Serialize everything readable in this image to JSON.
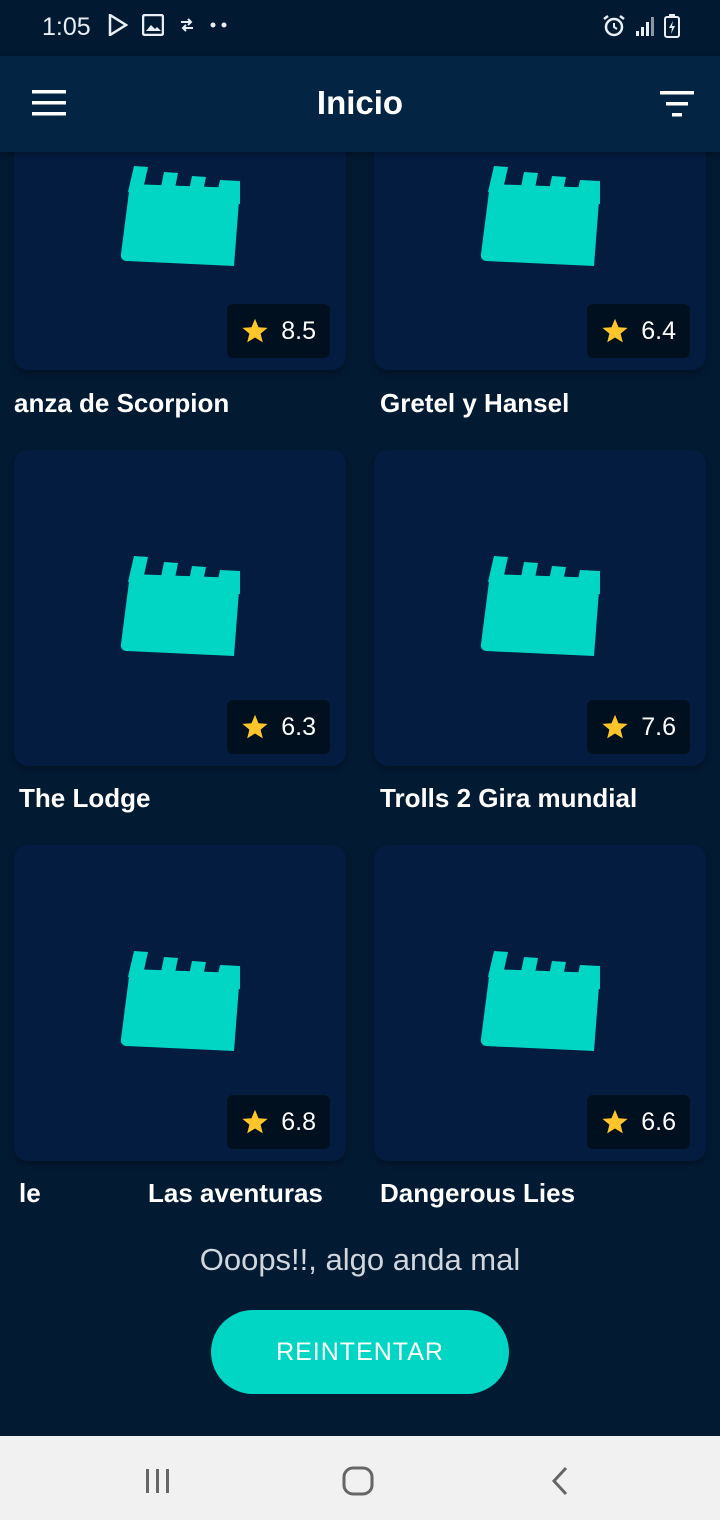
{
  "status_bar": {
    "time": "1:05",
    "icons": [
      "play-store-icon",
      "image-icon",
      "data-sync-icon",
      "more-dots-icon",
      "alarm-icon",
      "signal-icon",
      "battery-icon"
    ]
  },
  "app_bar": {
    "title": "Inicio",
    "icons": [
      "hamburger-menu-icon",
      "filter-icon"
    ]
  },
  "movies": [
    {
      "title": "anza de Scorpion",
      "rating": "8.5"
    },
    {
      "title": "Gretel y Hansel",
      "rating": "6.4"
    },
    {
      "title": "The Lodge",
      "rating": "6.3"
    },
    {
      "title": "Trolls 2 Gira mundial",
      "rating": "7.6"
    },
    {
      "title": "le",
      "title_2": "Las aventuras",
      "rating": "6.8"
    },
    {
      "title": "Dangerous Lies",
      "rating": "6.6"
    }
  ],
  "error": {
    "message": "Ooops!!, algo anda mal",
    "retry_label": "REINTENTAR"
  },
  "colors": {
    "background": "#031a33",
    "app_bar": "#032443",
    "card": "#041c40",
    "accent": "#00d6c3",
    "star": "#ffc52a"
  },
  "nav_bar": {
    "icons": [
      "recent-apps-icon",
      "home-icon",
      "back-icon"
    ]
  }
}
